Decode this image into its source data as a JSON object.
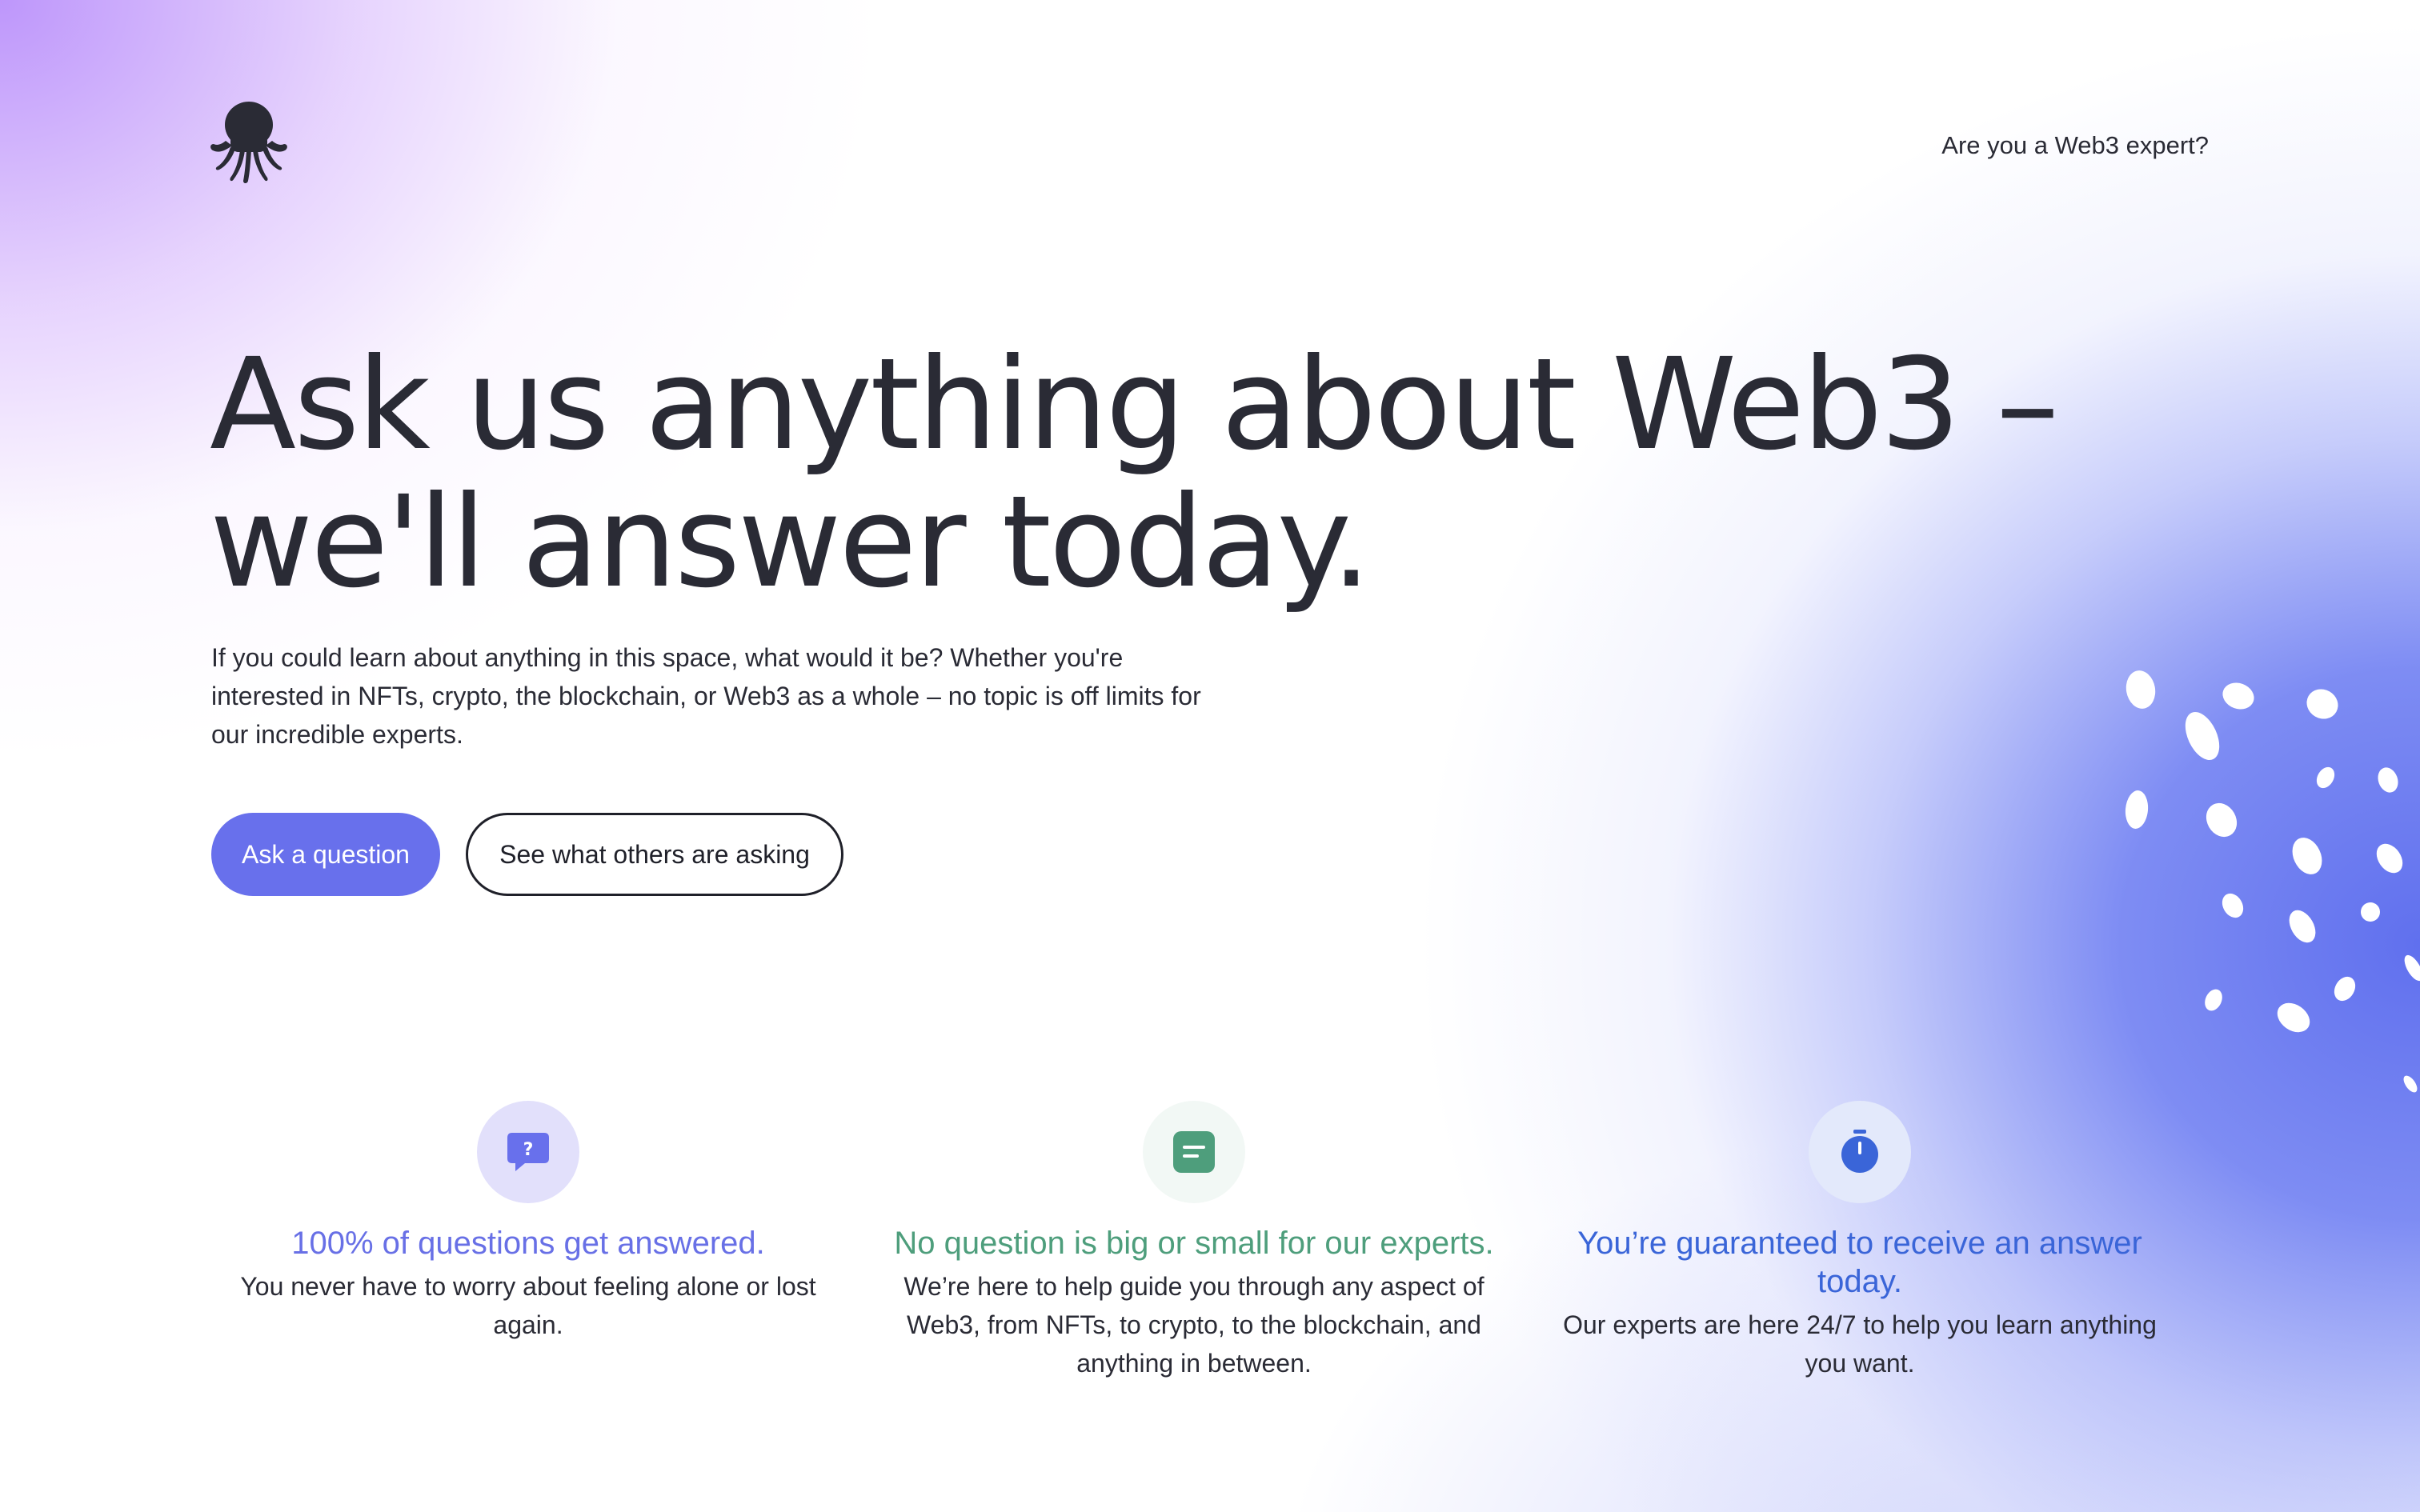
{
  "header": {
    "logo_icon": "octopus-icon",
    "expert_link": "Are you a Web3 expert?"
  },
  "hero": {
    "title_line1": "Ask us anything about Web3 –",
    "title_line2": "we'll answer today.",
    "lead": "If you could learn about anything in this space, what would it be? Whether you're interested in NFTs, crypto, the blockchain, or Web3 as a whole – no topic is off limits for our incredible experts.",
    "primary_button": "Ask a question",
    "secondary_button": "See what others are asking"
  },
  "features": [
    {
      "icon": "question-bubble-icon",
      "title": "100% of questions get answered.",
      "text": "You never have to worry about feeling alone or lost again.",
      "color": "#6870e6"
    },
    {
      "icon": "message-lines-icon",
      "title": "No question is big or small for our experts.",
      "text": "We’re here to help guide you through any aspect of Web3, from NFTs, to crypto, to the blockchain, and anything in between.",
      "color": "#4e9e7c"
    },
    {
      "icon": "stopwatch-icon",
      "title": "You’re guaranteed to receive an answer today.",
      "text": "Our experts are here 24/7 to help you learn anything you want.",
      "color": "#3a65d8"
    }
  ],
  "colors": {
    "accent": "#6870ec",
    "text": "#2a2b35"
  }
}
